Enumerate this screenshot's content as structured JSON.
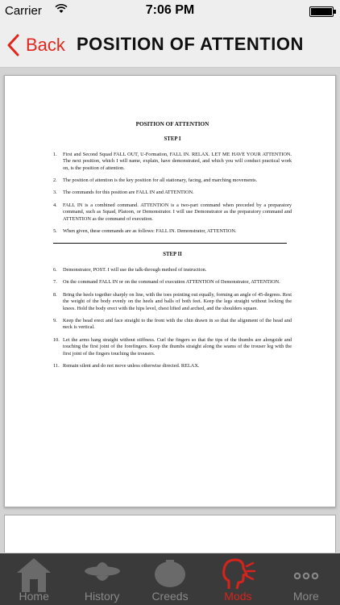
{
  "status_bar": {
    "carrier": "Carrier",
    "time": "7:06 PM"
  },
  "nav": {
    "back_label": "Back",
    "title": "POSITION OF ATTENTION"
  },
  "document": {
    "title": "POSITION OF ATTENTION",
    "step1": "STEP I",
    "step1_items": [
      {
        "num": "1.",
        "text": "First and Second Squad FALL OUT, U-Formation, FALL IN. RELAX. LET ME HAVE YOUR ATTENTION. The next position, which I will name, explain, have demonstrated, and which you will conduct practical work on, is the position of attention."
      },
      {
        "num": "2.",
        "text": "The position of attention is the key position for all stationary, facing, and marching movements."
      },
      {
        "num": "3.",
        "text": "The commands for this position are FALL IN and ATTENTION."
      },
      {
        "num": "4.",
        "text": "FALL IN is a combined command. ATTENTION is a two-part command when preceded by a preparatory command, such as Squad, Platoon, or Demonstrator. I will use Demonstrator as the preparatory command and ATTENTION as the command of execution."
      },
      {
        "num": "5.",
        "text": "When given, these commands are as follows: FALL IN. Demonstrator, ATTENTION."
      }
    ],
    "step2": "STEP II",
    "step2_items": [
      {
        "num": "6.",
        "text": "Demonstrator, POST. I will use the talk-through method of instruction."
      },
      {
        "num": "7.",
        "text": "On the command FALL IN or on the command of execution ATTENTION of Demonstrator, ATTENTION."
      },
      {
        "num": "8.",
        "text": "Bring the heels together sharply on line, with the toes pointing out equally, forming an angle of 45-degrees. Rest the weight of the body evenly on the heels and balls of both feet. Keep the legs straight without locking the knees. Hold the body erect with the hips level, chest lifted and arched, and the shoulders square."
      },
      {
        "num": "9.",
        "text": "Keep the head erect and face straight to the front with the chin drawn in so that the alignment of the head and neck is vertical."
      },
      {
        "num": "10.",
        "text": "Let the arms hang straight without stiffness. Curl the fingers so that the tips of the thumbs are alongside and touching the first joint of the forefingers. Keep the thumbs straight along the seams of the trouser leg with the first joint of the fingers touching the trousers."
      },
      {
        "num": "11.",
        "text": "Remain silent and do not move unless otherwise directed. RELAX."
      }
    ]
  },
  "tabs": [
    {
      "label": "Home",
      "icon": "house-icon"
    },
    {
      "label": "History",
      "icon": "campaign-hat-icon"
    },
    {
      "label": "Creeds",
      "icon": "shield-icon"
    },
    {
      "label": "Mods",
      "icon": "shouting-head-icon"
    },
    {
      "label": "More",
      "icon": "more-icon"
    }
  ],
  "colors": {
    "accent": "#d8231c",
    "tab_bar_bg": "#3a3a3a",
    "nav_bg": "#eeeeee"
  }
}
